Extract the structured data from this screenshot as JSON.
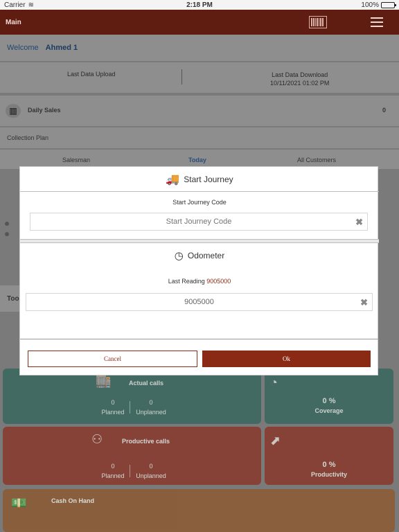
{
  "statusbar": {
    "carrier": "Carrier",
    "time": "2:18 PM",
    "battery": "100%"
  },
  "topbar": {
    "title": "Main"
  },
  "welcome": {
    "label": "Welcome",
    "user": "Ahmed 1"
  },
  "sync": {
    "last_upload": "Last Data Upload",
    "last_download": "Last Data Download",
    "download_time": "10/11/2021 01:02 PM"
  },
  "daily_sales": {
    "label": "Daily Sales",
    "value": "0"
  },
  "collection_plan": {
    "label": "Collection Plan"
  },
  "tabs": {
    "salesman": "Salesman",
    "today": "Today",
    "all_customers": "All Customers"
  },
  "dialog": {
    "journey": {
      "title": "Start Journey",
      "label": "Start Journey Code",
      "placeholder": "Start Journey Code"
    },
    "odometer": {
      "title": "Odometer",
      "last_reading_label": "Last Reading",
      "last_reading_value": "9005000",
      "value": "9005000"
    },
    "cancel_label": "Cancel",
    "ok_label": "Ok"
  },
  "tiles": {
    "actual_calls": {
      "title": "Actual calls",
      "planned": "0",
      "planned_label": "Planned",
      "unplanned": "0",
      "unplanned_label": "Unplanned"
    },
    "coverage": {
      "value": "0 %",
      "label": "Coverage"
    },
    "productive_calls": {
      "title": "Productive calls",
      "planned": "0",
      "planned_label": "Planned",
      "unplanned": "0",
      "unplanned_label": "Unplanned"
    },
    "productivity": {
      "value": "0 %",
      "label": "Productivity"
    },
    "cash_on_hand": {
      "title": "Cash On Hand"
    }
  },
  "partial_text": {
    "today_stub": "Too"
  },
  "colors": {
    "brand": "#8a2a15",
    "header": "#5e1d10",
    "teal": "#30655b",
    "brick": "#8a3526",
    "amber": "#8c5a33"
  }
}
